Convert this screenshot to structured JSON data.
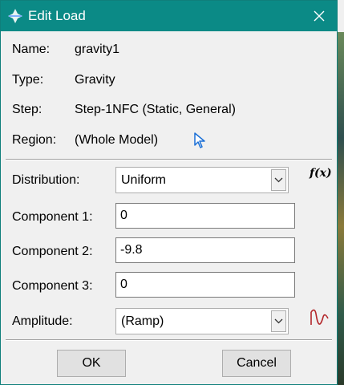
{
  "window": {
    "title": "Edit Load",
    "close_glyph": "✕"
  },
  "info": {
    "name_label": "Name:",
    "name_value": "gravity1",
    "type_label": "Type:",
    "type_value": "Gravity",
    "step_label": "Step:",
    "step_value": "Step-1NFC (Static, General)",
    "region_label": "Region:",
    "region_value": "(Whole Model)"
  },
  "form": {
    "distribution_label": "Distribution:",
    "distribution_value": "Uniform",
    "fx_label": "f(x)",
    "component1_label": "Component 1:",
    "component1_value": "0",
    "component2_label": "Component 2:",
    "component2_value": "-9.8",
    "component3_label": "Component 3:",
    "component3_value": "0",
    "amplitude_label": "Amplitude:",
    "amplitude_value": "(Ramp)"
  },
  "buttons": {
    "ok": "OK",
    "cancel": "Cancel"
  },
  "colors": {
    "titlebar": "#0b8a86",
    "accent_cursor": "#1a6fd6",
    "amplitude_icon": "#b3262a"
  }
}
